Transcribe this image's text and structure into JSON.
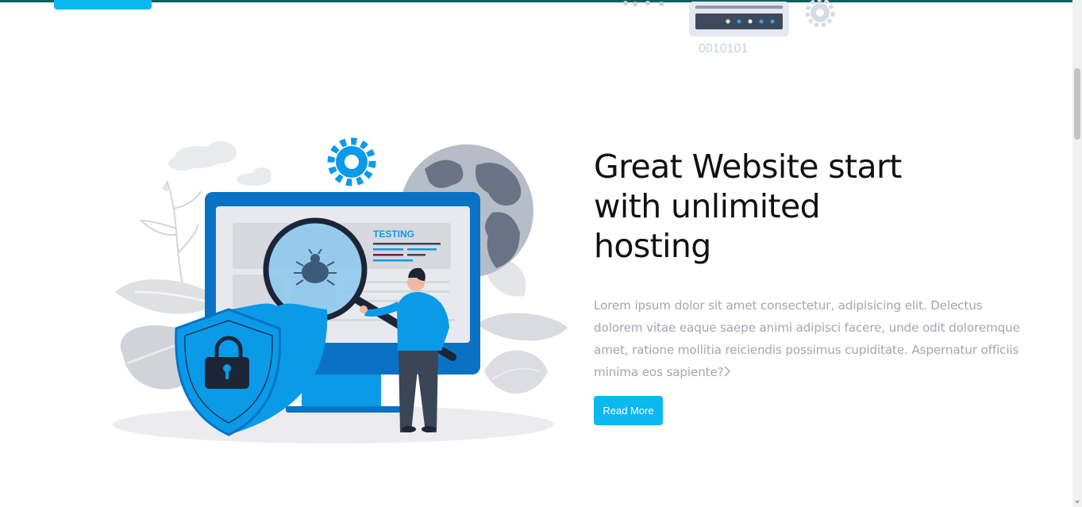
{
  "previous_section": {
    "binary_text": "0010101"
  },
  "illustration": {
    "screen_label": "TESTING",
    "icons": [
      "gear-icon",
      "globe-icon",
      "bug-icon",
      "magnifier-icon",
      "shield-lock-icon",
      "cloud-icon"
    ],
    "colors": {
      "primary_blue": "#0a9ae8",
      "dark_blue": "#0a72c4",
      "grey_light": "#e3e5ea",
      "grey_mid": "#c9ccd3",
      "grey_dark": "#6b7380"
    }
  },
  "hero": {
    "title": "Great Website start with unlimited hosting",
    "body": "Lorem ipsum dolor sit amet consectetur, adipisicing elit. Delectus dolorem vitae eaque saepe animi adipisci facere, unde odit doloremque amet, ratione mollitia reiciendis possimus cupiditate. Aspernatur officiis minima eos sapiente?",
    "body_trailing_icon": "chevron-right-icon",
    "read_more_label": "Read More"
  },
  "colors": {
    "accent": "#0bb8f0",
    "top_border": "#0e5e5e",
    "title": "#111111",
    "body_text": "#a5a5b0"
  }
}
